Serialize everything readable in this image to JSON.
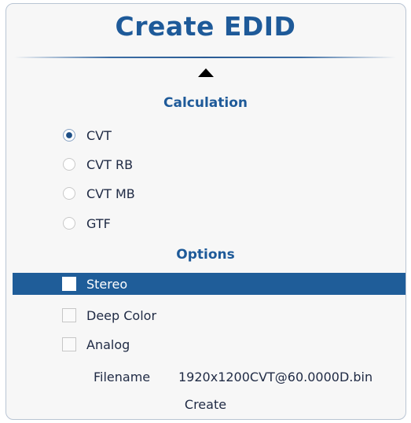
{
  "title": "Create EDID",
  "calculation": {
    "heading": "Calculation",
    "options": [
      {
        "label": "CVT",
        "checked": true
      },
      {
        "label": "CVT RB",
        "checked": false
      },
      {
        "label": "CVT MB",
        "checked": false
      },
      {
        "label": "GTF",
        "checked": false
      }
    ]
  },
  "options": {
    "heading": "Options",
    "items": [
      {
        "label": "Stereo",
        "checked": false,
        "highlighted": true
      },
      {
        "label": "Deep Color",
        "checked": false,
        "highlighted": false
      },
      {
        "label": "Analog",
        "checked": false,
        "highlighted": false
      }
    ]
  },
  "filename": {
    "label": "Filename",
    "value": "1920x1200CVT@60.0000D.bin"
  },
  "create_label": "Create",
  "colors": {
    "accent": "#1e5a99",
    "highlight": "#1f5d99",
    "text": "#1f2a44"
  }
}
